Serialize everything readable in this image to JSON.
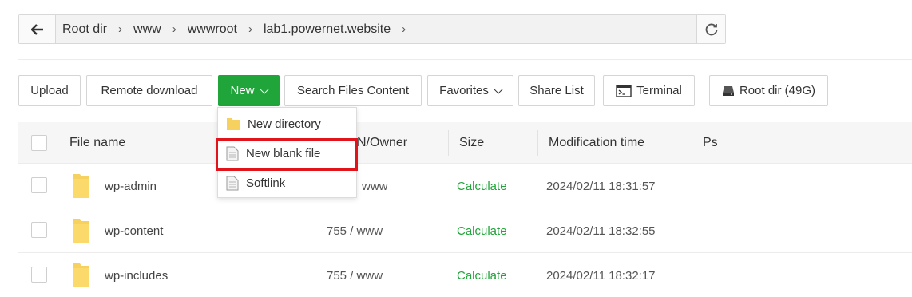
{
  "breadcrumb": {
    "items": [
      "Root dir",
      "www",
      "wwwroot",
      "lab1.powernet.website"
    ]
  },
  "toolbar": {
    "upload": "Upload",
    "remote_download": "Remote download",
    "new": "New",
    "search_files": "Search Files Content",
    "favorites": "Favorites",
    "share_list": "Share List",
    "terminal": "Terminal",
    "root_dir": "Root dir (49G)"
  },
  "new_menu": {
    "items": [
      "New directory",
      "New blank file",
      "Softlink"
    ]
  },
  "table": {
    "headers": {
      "name": "File name",
      "owner": "N/Owner",
      "size": "Size",
      "modified": "Modification time",
      "ps": "Ps"
    },
    "rows": [
      {
        "name": "wp-admin",
        "owner": "www",
        "size": "Calculate",
        "modified": "2024/02/11 18:31:57"
      },
      {
        "name": "wp-content",
        "owner": "755 / www",
        "size": "Calculate",
        "modified": "2024/02/11 18:32:55"
      },
      {
        "name": "wp-includes",
        "owner": "755 / www",
        "size": "Calculate",
        "modified": "2024/02/11 18:32:17"
      }
    ]
  },
  "colors": {
    "accent_green": "#20a53a",
    "highlight_red": "#e1131b",
    "folder_yellow": "#f7d15f"
  }
}
